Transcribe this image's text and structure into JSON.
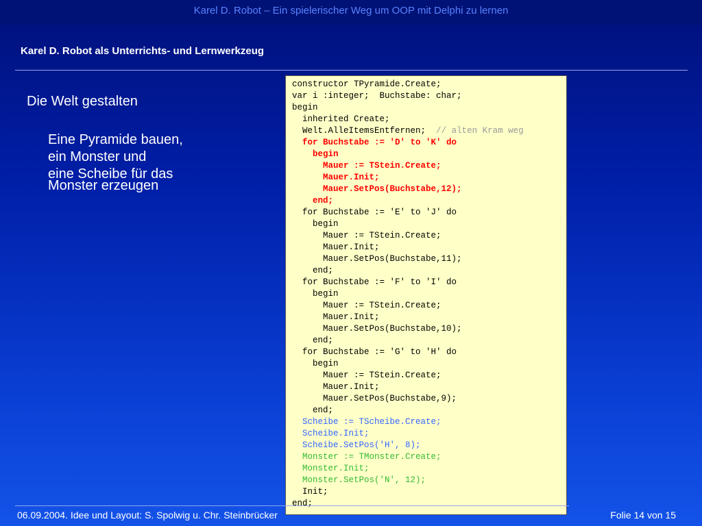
{
  "header": {
    "title": "Karel D. Robot – Ein spielerischer Weg um OOP mit Delphi zu lernen"
  },
  "slide": {
    "section_title": "Karel D. Robot als Unterrichts- und Lernwerkzeug",
    "heading": "Die Welt gestalten",
    "description": [
      "Eine Pyramide bauen,",
      "ein Monster und",
      "eine Scheibe für das",
      "Monster erzeugen"
    ]
  },
  "code_lines": [
    {
      "indent": 0,
      "text": "constructor TPyramide.Create;",
      "style": "normal"
    },
    {
      "indent": 0,
      "text": "var i :integer;  Buchstabe: char;",
      "style": "normal"
    },
    {
      "indent": 0,
      "text": "begin",
      "style": "normal"
    },
    {
      "indent": 2,
      "text": "inherited Create;",
      "style": "normal"
    },
    {
      "indent": 2,
      "text": "Welt.AlleItemsEntfernen;",
      "style": "normal",
      "comment": "// alten Kram weg"
    },
    {
      "indent": 2,
      "text": "for Buchstabe := 'D' to 'K' do",
      "style": "red"
    },
    {
      "indent": 4,
      "text": "begin",
      "style": "red"
    },
    {
      "indent": 6,
      "text": "Mauer := TStein.Create;",
      "style": "red"
    },
    {
      "indent": 6,
      "text": "Mauer.Init;",
      "style": "red"
    },
    {
      "indent": 6,
      "text": "Mauer.SetPos(Buchstabe,12);",
      "style": "red"
    },
    {
      "indent": 4,
      "text": "end;",
      "style": "red"
    },
    {
      "indent": 2,
      "text": "for Buchstabe := 'E' to 'J' do",
      "style": "normal"
    },
    {
      "indent": 4,
      "text": "begin",
      "style": "normal"
    },
    {
      "indent": 6,
      "text": "Mauer := TStein.Create;",
      "style": "normal"
    },
    {
      "indent": 6,
      "text": "Mauer.Init;",
      "style": "normal"
    },
    {
      "indent": 6,
      "text": "Mauer.SetPos(Buchstabe,11);",
      "style": "normal"
    },
    {
      "indent": 4,
      "text": "end;",
      "style": "normal"
    },
    {
      "indent": 2,
      "text": "for Buchstabe := 'F' to 'I' do",
      "style": "normal"
    },
    {
      "indent": 4,
      "text": "begin",
      "style": "normal"
    },
    {
      "indent": 6,
      "text": "Mauer := TStein.Create;",
      "style": "normal"
    },
    {
      "indent": 6,
      "text": "Mauer.Init;",
      "style": "normal"
    },
    {
      "indent": 6,
      "text": "Mauer.SetPos(Buchstabe,10);",
      "style": "normal"
    },
    {
      "indent": 4,
      "text": "end;",
      "style": "normal"
    },
    {
      "indent": 2,
      "text": "for Buchstabe := 'G' to 'H' do",
      "style": "normal"
    },
    {
      "indent": 4,
      "text": "begin",
      "style": "normal"
    },
    {
      "indent": 6,
      "text": "Mauer := TStein.Create;",
      "style": "normal"
    },
    {
      "indent": 6,
      "text": "Mauer.Init;",
      "style": "normal"
    },
    {
      "indent": 6,
      "text": "Mauer.SetPos(Buchstabe,9);",
      "style": "normal"
    },
    {
      "indent": 4,
      "text": "end;",
      "style": "normal"
    },
    {
      "indent": 2,
      "text": "Scheibe := TScheibe.Create;",
      "style": "blue"
    },
    {
      "indent": 2,
      "text": "Scheibe.Init;",
      "style": "blue"
    },
    {
      "indent": 2,
      "text": "Scheibe.SetPos('H', 8);",
      "style": "blue"
    },
    {
      "indent": 2,
      "text": "Monster := TMonster.Create;",
      "style": "green"
    },
    {
      "indent": 2,
      "text": "Monster.Init;",
      "style": "green"
    },
    {
      "indent": 2,
      "text": "Monster.SetPos('N', 12);",
      "style": "green"
    },
    {
      "indent": 2,
      "text": "Init;",
      "style": "normal"
    },
    {
      "indent": 0,
      "text": "end;",
      "style": "normal"
    }
  ],
  "footer": {
    "left": "06.09.2004.  Idee und Layout:  S. Spolwig u. Chr. Steinbrücker",
    "right": "Folie 14 von 15"
  },
  "colors": {
    "background_top": "#00107a",
    "background_bottom": "#1453e8",
    "code_background": "#ffffc8",
    "highlight_red": "#ff0000",
    "highlight_blue": "#3366ff",
    "highlight_green": "#33bb33",
    "comment_gray": "#9a9a9a"
  }
}
